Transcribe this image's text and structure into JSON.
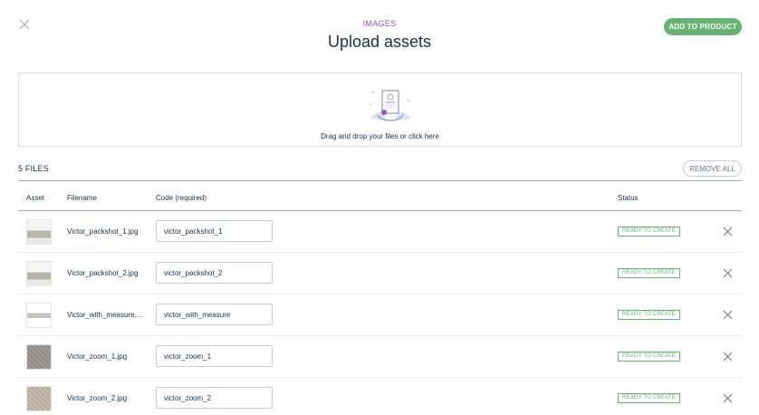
{
  "header": {
    "subtitle": "IMAGES",
    "title": "Upload assets",
    "add_button": "ADD TO PRODUCT"
  },
  "dropzone": {
    "text": "Drag and drop your files or click here",
    "icon": "upload-illustration-icon"
  },
  "files": {
    "count_label": "5 FILES",
    "remove_all": "REMOVE ALL"
  },
  "table": {
    "columns": [
      "Asset",
      "Filename",
      "Code (required)",
      "Status"
    ],
    "rows": [
      {
        "filename": "Victor_packshot_1.jpg",
        "code": "victor_packshot_1",
        "status": "READY TO CREATE",
        "thumb": "sofa"
      },
      {
        "filename": "Victor_packshot_2.jpg",
        "code": "victor_packshot_2",
        "status": "READY TO CREATE",
        "thumb": "sofa"
      },
      {
        "filename": "Victor_with_measure....",
        "code": "victor_with_measure",
        "status": "READY TO CREATE",
        "thumb": "measure"
      },
      {
        "filename": "Victor_zoom_1.jpg",
        "code": "victor_zoom_1",
        "status": "READY TO CREATE",
        "thumb": "fabric-dark"
      },
      {
        "filename": "Victor_zoom_2.jpg",
        "code": "victor_zoom_2",
        "status": "READY TO CREATE",
        "thumb": "fabric-light"
      }
    ]
  },
  "colors": {
    "accent_purple": "#9452ba",
    "success_green": "#67b373",
    "text_dark": "#11324d"
  }
}
